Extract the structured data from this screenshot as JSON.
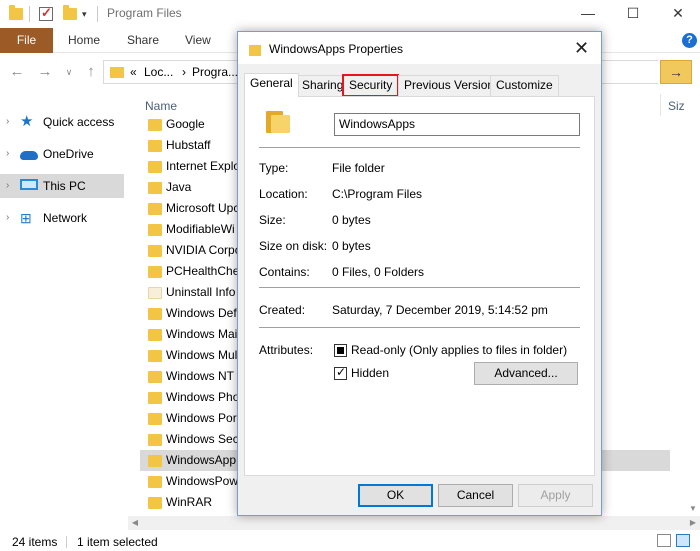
{
  "window": {
    "title": "Program Files",
    "controls": [
      "—",
      "☐",
      "✕"
    ]
  },
  "ribbon": {
    "file": "File",
    "tabs": [
      "Home",
      "Share",
      "View"
    ],
    "help": "?"
  },
  "address": {
    "prefix": "«",
    "part1": "Loc...",
    "sep": "›",
    "part2": "Progra..."
  },
  "navigation": {
    "items": [
      {
        "label": "Quick access",
        "icon": "star-icon"
      },
      {
        "label": "OneDrive",
        "icon": "cloud-icon"
      },
      {
        "label": "This PC",
        "icon": "computer-icon",
        "selected": true
      },
      {
        "label": "Network",
        "icon": "network-icon"
      }
    ]
  },
  "file_list": {
    "name_header": "Name",
    "size_header": "Siz",
    "items": [
      "Google",
      "Hubstaff",
      "Internet Explo",
      "Java",
      "Microsoft Upc",
      "ModifiableWi",
      "NVIDIA Corpc",
      "PCHealthChe",
      "Uninstall Info",
      "Windows Defe",
      "Windows Mai",
      "Windows Mul",
      "Windows NT",
      "Windows Pho",
      "Windows Port",
      "Windows Secu",
      "WindowsApp",
      "WindowsPow",
      "WinRAR"
    ],
    "selected_index": 16,
    "plain_icon_index": 8
  },
  "status": {
    "count": "24 items",
    "selected": "1 item selected"
  },
  "dialog": {
    "title": "WindowsApps Properties",
    "close": "✕",
    "tabs": [
      "General",
      "Sharing",
      "Security",
      "Previous Versions",
      "Customize"
    ],
    "active_tab": "General",
    "highlighted_tab": "Security",
    "name": "WindowsApps",
    "properties": [
      {
        "label": "Type:",
        "value": "File folder"
      },
      {
        "label": "Location:",
        "value": "C:\\Program Files"
      },
      {
        "label": "Size:",
        "value": "0 bytes"
      },
      {
        "label": "Size on disk:",
        "value": "0 bytes"
      },
      {
        "label": "Contains:",
        "value": "0 Files, 0 Folders"
      }
    ],
    "created": {
      "label": "Created:",
      "value": "Saturday, 7 December 2019, 5:14:52 pm"
    },
    "attributes": {
      "label": "Attributes:",
      "readonly": "Read-only (Only applies to files in folder)",
      "hidden": "Hidden",
      "advanced": "Advanced..."
    },
    "buttons": {
      "ok": "OK",
      "cancel": "Cancel",
      "apply": "Apply"
    }
  },
  "colors": {
    "file_tab": "#9b5a26",
    "highlight": "#e8141e",
    "folder": "#f3c544"
  }
}
